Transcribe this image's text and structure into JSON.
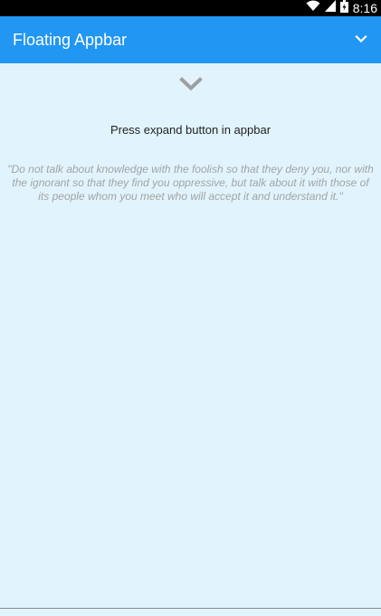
{
  "status_bar": {
    "time": "8:16",
    "icons": [
      "wifi-icon",
      "signal-icon",
      "battery-icon"
    ]
  },
  "appbar": {
    "title": "Floating Appbar",
    "expand_icon": "chevron-down-icon"
  },
  "content": {
    "chevron_icon": "chevron-down-icon",
    "instruction": "Press expand button in appbar",
    "quote": "\"Do not talk about knowledge with the foolish so that they deny you, nor with the ignorant so that they find you oppressive, but talk about it with those of its people whom you meet who will accept it and understand it.\""
  },
  "colors": {
    "appbar": "#2196f3",
    "background": "#e1f4fd",
    "status_bar": "#000000",
    "chevron": "#9e9e9e",
    "quote_text": "#a3a3a3"
  }
}
